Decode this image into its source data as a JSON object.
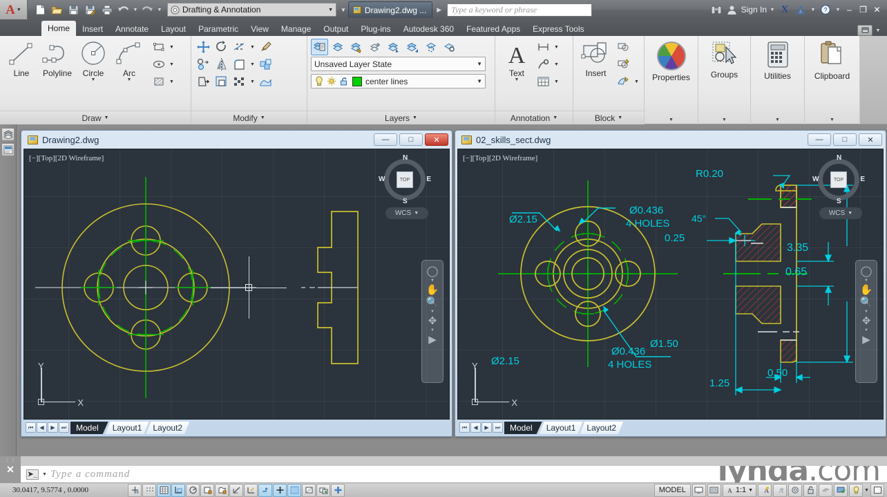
{
  "titlebar": {
    "app_icon": "autocad-a-logo",
    "quick_access": [
      {
        "name": "new-file",
        "icon": "new-document-icon"
      },
      {
        "name": "open-file",
        "icon": "open-folder-icon"
      },
      {
        "name": "save-file",
        "icon": "floppy-save-icon"
      },
      {
        "name": "save-as",
        "icon": "floppy-save-as-icon"
      },
      {
        "name": "plot",
        "icon": "printer-icon"
      },
      {
        "name": "undo",
        "icon": "undo-arrow-icon"
      },
      {
        "name": "redo",
        "icon": "redo-arrow-icon"
      }
    ],
    "workspace": "Drafting & Annotation",
    "document_tab": "Drawing2.dwg ...",
    "search_placeholder": "Type a keyword or phrase",
    "sign_in": "Sign In",
    "window_buttons": {
      "minimize": "–",
      "restore": "❐",
      "close": "✕"
    }
  },
  "ribbon": {
    "tabs": [
      {
        "label": "Home",
        "active": true
      },
      {
        "label": "Insert",
        "active": false
      },
      {
        "label": "Annotate",
        "active": false
      },
      {
        "label": "Layout",
        "active": false
      },
      {
        "label": "Parametric",
        "active": false
      },
      {
        "label": "View",
        "active": false
      },
      {
        "label": "Manage",
        "active": false
      },
      {
        "label": "Output",
        "active": false
      },
      {
        "label": "Plug-ins",
        "active": false
      },
      {
        "label": "Autodesk 360",
        "active": false
      },
      {
        "label": "Featured Apps",
        "active": false
      },
      {
        "label": "Express Tools",
        "active": false
      }
    ],
    "panels": {
      "draw": {
        "title": "Draw",
        "buttons": [
          {
            "label": "Line",
            "icon": "line-icon"
          },
          {
            "label": "Polyline",
            "icon": "polyline-icon"
          },
          {
            "label": "Circle",
            "icon": "circle-icon"
          },
          {
            "label": "Arc",
            "icon": "arc-icon"
          }
        ],
        "small": [
          "rectangle-icon",
          "ellipse-icon",
          "hatch-icon"
        ]
      },
      "modify": {
        "title": "Modify",
        "small": [
          "move-icon",
          "rotate-icon",
          "trim-icon",
          "match-properties-icon",
          "copy-icon",
          "mirror-icon",
          "fillet-icon",
          "explode-icon",
          "stretch-icon",
          "scale-icon",
          "array-icon",
          "extrude-icon"
        ]
      },
      "layers": {
        "title": "Layers",
        "layer_state": "Unsaved Layer State",
        "current_layer": "center lines",
        "layer_color": "#00d200",
        "small": [
          "layer-properties-icon",
          "layer-off-icon",
          "layer-freeze-icon",
          "layer-isolate-icon",
          "layer-match-icon",
          "layer-previous-icon",
          "layer-make-current-icon",
          "layer-walk-icon"
        ]
      },
      "annotation": {
        "title": "Annotation",
        "buttons": [
          {
            "label": "Text",
            "icon": "text-a-icon"
          }
        ],
        "small": [
          "dimension-icon",
          "leader-icon",
          "table-icon"
        ]
      },
      "block": {
        "title": "Block",
        "buttons": [
          {
            "label": "Insert",
            "icon": "insert-block-icon"
          }
        ],
        "small": [
          "create-block-icon",
          "edit-block-icon",
          "block-attribute-icon"
        ]
      },
      "properties": {
        "title": "Properties",
        "label": "Properties",
        "icon": "color-wheel-icon"
      },
      "groups": {
        "title": "Groups",
        "label": "Groups",
        "icon": "group-select-icon"
      },
      "utilities": {
        "title": "Utilities",
        "label": "Utilities",
        "icon": "calculator-icon"
      },
      "clipboard": {
        "title": "Clipboard",
        "label": "Clipboard",
        "icon": "clipboard-icon"
      }
    }
  },
  "left_dock": [
    {
      "name": "sheet-set-manager",
      "icon": "layers-stack-icon"
    },
    {
      "name": "properties-palette",
      "icon": "properties-palette-icon"
    }
  ],
  "windows": [
    {
      "id": "left",
      "title": "Drawing2.dwg",
      "viewport_label": "[−][Top][2D Wireframe]",
      "active": true,
      "controls": {
        "minimize": "—",
        "restore": "□",
        "close": "✕"
      },
      "viewcube": {
        "north": "N",
        "south": "S",
        "east": "E",
        "west": "W",
        "face": "TOP",
        "ucs": "WCS"
      },
      "ucs_icon": {
        "x": "X",
        "y": "Y"
      },
      "tabs": [
        {
          "label": "Model",
          "active": true
        },
        {
          "label": "Layout1",
          "active": false
        },
        {
          "label": "Layout2",
          "active": false
        }
      ],
      "annotations": []
    },
    {
      "id": "right",
      "title": "02_skills_sect.dwg",
      "viewport_label": "[−][Top][2D Wireframe]",
      "active": false,
      "controls": {
        "minimize": "—",
        "restore": "□",
        "close": "✕"
      },
      "viewcube": {
        "north": "N",
        "south": "S",
        "east": "E",
        "west": "W",
        "face": "TOP",
        "ucs": "WCS"
      },
      "ucs_icon": {
        "x": "X",
        "y": "Y"
      },
      "tabs": [
        {
          "label": "Model",
          "active": true
        },
        {
          "label": "Layout1",
          "active": false
        },
        {
          "label": "Layout2",
          "active": false
        }
      ],
      "annotations": [
        {
          "name": "dim-outer-diameter",
          "text": "Ø2.15"
        },
        {
          "name": "dim-hole-diameter",
          "text": "Ø0.436"
        },
        {
          "name": "dim-hole-count",
          "text": "4 HOLES"
        },
        {
          "name": "dim-bore-diameter",
          "text": "Ø1.50"
        },
        {
          "name": "dim-fillet-radius",
          "text": "R0.20"
        },
        {
          "name": "dim-chamfer-angle",
          "text": "45°"
        },
        {
          "name": "dim-chamfer-size",
          "text": "0.25"
        },
        {
          "name": "dim-total-height",
          "text": "3.35"
        },
        {
          "name": "dim-mid-height",
          "text": "0.65"
        },
        {
          "name": "dim-flange-width",
          "text": "0.50"
        },
        {
          "name": "dim-overall-width",
          "text": "1.25"
        }
      ]
    }
  ],
  "command_line": {
    "prompt_glyph": "➤_",
    "placeholder": "Type  a  command",
    "close_glyph": "✕",
    "watermark": "lynda.com",
    "watermark_bold": "lynda",
    "watermark_rest": ".com"
  },
  "statusbar": {
    "coordinates": "30.0417, 9.5774 , 0.0000",
    "toggles": [
      {
        "name": "infer-constraints",
        "icon": "infer-constraints-icon",
        "on": false
      },
      {
        "name": "snap-mode",
        "icon": "snap-grid-icon",
        "on": false
      },
      {
        "name": "grid-display",
        "icon": "grid-icon",
        "on": true
      },
      {
        "name": "ortho-mode",
        "icon": "ortho-icon",
        "on": true
      },
      {
        "name": "polar-tracking",
        "icon": "polar-icon",
        "on": false
      },
      {
        "name": "object-snap",
        "icon": "osnap-icon",
        "on": false
      },
      {
        "name": "3d-object-snap",
        "icon": "osnap3d-icon",
        "on": false
      },
      {
        "name": "object-snap-tracking",
        "icon": "otrack-icon",
        "on": false
      },
      {
        "name": "allow-ucs",
        "icon": "ucs-icon",
        "on": false
      },
      {
        "name": "dynamic-ucs",
        "icon": "dynamic-ucs-icon",
        "on": true
      },
      {
        "name": "dynamic-input",
        "icon": "dyninput-icon",
        "on": true
      },
      {
        "name": "lineweight",
        "icon": "lineweight-icon",
        "on": true
      },
      {
        "name": "transparency",
        "icon": "transparency-icon",
        "on": false
      },
      {
        "name": "selection-cycling",
        "icon": "selection-cycling-icon",
        "on": false
      },
      {
        "name": "annotation-monitor",
        "icon": "annotation-monitor-icon",
        "on": false
      }
    ],
    "model_label": "MODEL",
    "annotation_scale": "1:1",
    "right_icons": [
      {
        "name": "model-space",
        "icon": "model-space-icon"
      },
      {
        "name": "layout-space",
        "icon": "layout-space-icon"
      },
      {
        "name": "annotation-visibility",
        "icon": "annotation-visibility-icon"
      },
      {
        "name": "auto-scale",
        "icon": "auto-scale-icon"
      },
      {
        "name": "workspace-switch",
        "icon": "gear-icon"
      },
      {
        "name": "toolbar-lock",
        "icon": "lock-icon"
      },
      {
        "name": "isolate-objects",
        "icon": "isolate-objects-icon"
      },
      {
        "name": "hardware-acceleration",
        "icon": "hardware-accel-icon"
      },
      {
        "name": "clean-screen",
        "icon": "clean-screen-icon"
      }
    ]
  }
}
